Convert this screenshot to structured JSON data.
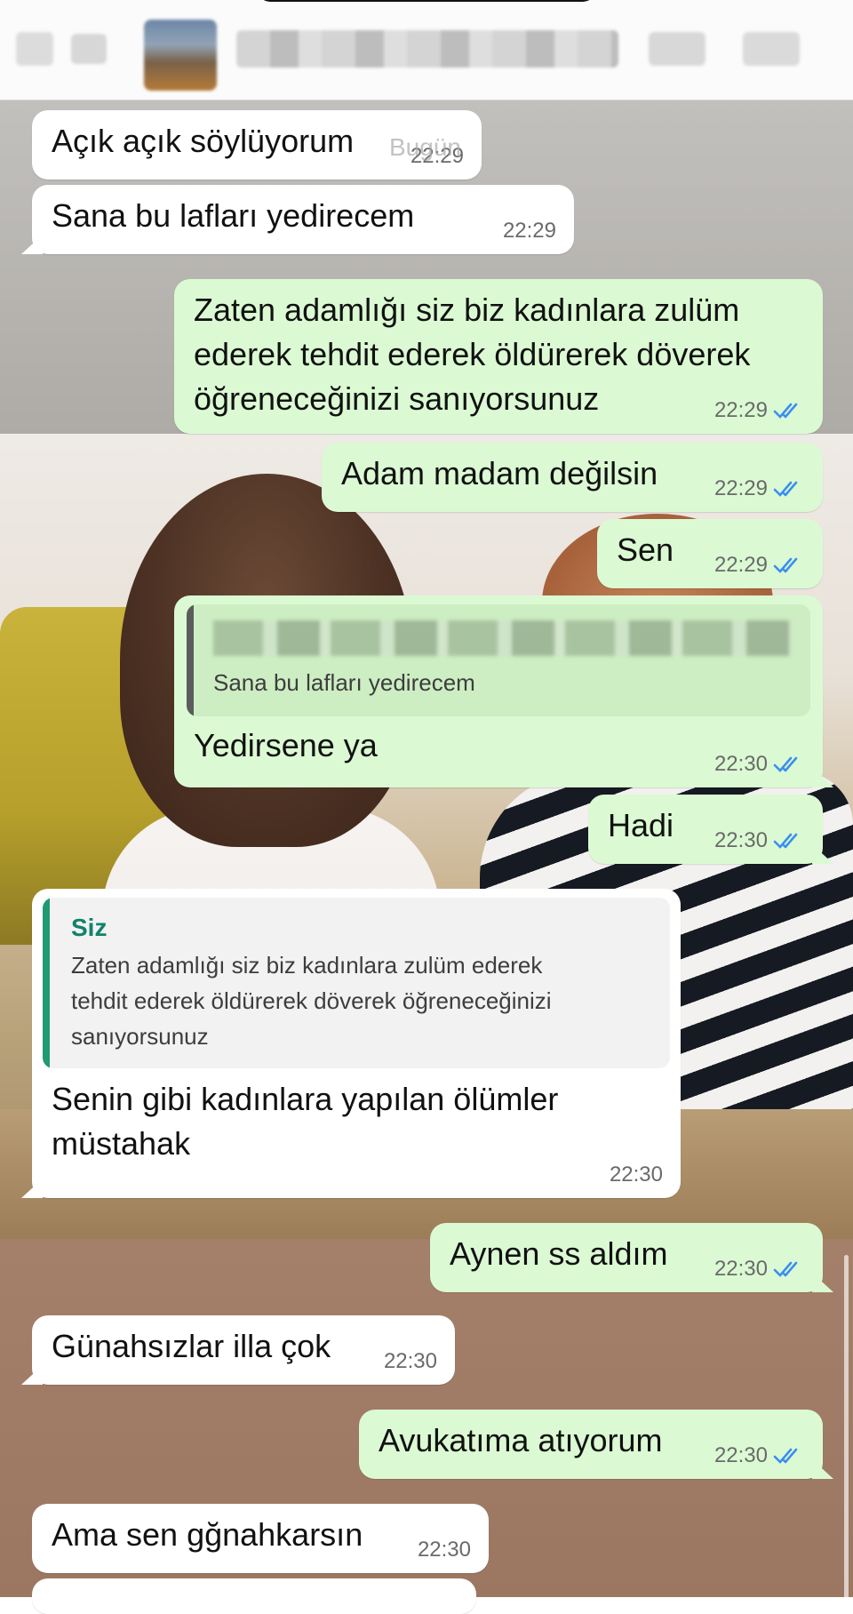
{
  "header": {
    "back_icon": "chevron-left-icon",
    "video_icon": "video-camera-icon",
    "call_icon": "phone-icon"
  },
  "date_chip": "Bugün",
  "messages": [
    {
      "dir": "in",
      "text": "Açık açık söylüyorum",
      "time": "22:29"
    },
    {
      "dir": "in",
      "text": "Sana bu lafları yedirecem",
      "time": "22:29"
    },
    {
      "dir": "out",
      "text": "Zaten adamlığı siz biz kadınlara zulüm\nederek tehdit ederek öldürerek döverek\nöğreneceğinizi sanıyorsunuz",
      "time": "22:29"
    },
    {
      "dir": "out",
      "text": "Adam madam değilsin",
      "time": "22:29"
    },
    {
      "dir": "out",
      "text": "Sen",
      "time": "22:29"
    },
    {
      "dir": "out",
      "text": "Yedirsene ya",
      "time": "22:30",
      "quote": {
        "author": "",
        "text": "Sana bu lafları yedirecem"
      }
    },
    {
      "dir": "out",
      "text": "Hadi",
      "time": "22:30"
    },
    {
      "dir": "in",
      "text": "Senin gibi kadınlara yapılan ölümler\nmüstahak",
      "time": "22:30",
      "quote": {
        "author": "Siz",
        "text": "Zaten adamlığı siz biz kadınlara zulüm ederek\ntehdit ederek öldürerek döverek öğreneceğinizi\nsanıyorsunuz"
      }
    },
    {
      "dir": "out",
      "text": "Aynen ss aldım",
      "time": "22:30"
    },
    {
      "dir": "in",
      "text": "Günahsızlar illa çok",
      "time": "22:30"
    },
    {
      "dir": "out",
      "text": "Avukatıma atıyorum",
      "time": "22:30"
    },
    {
      "dir": "in",
      "text": "Ama sen gğnahkarsın",
      "time": "22:30"
    }
  ],
  "colors": {
    "incoming_bubble": "#ffffff",
    "outgoing_bubble": "#dbfad3",
    "read_ticks": "#3b8ef0",
    "quote_author": "#11826a"
  },
  "icons": {
    "read_receipt": "double-check-icon"
  }
}
